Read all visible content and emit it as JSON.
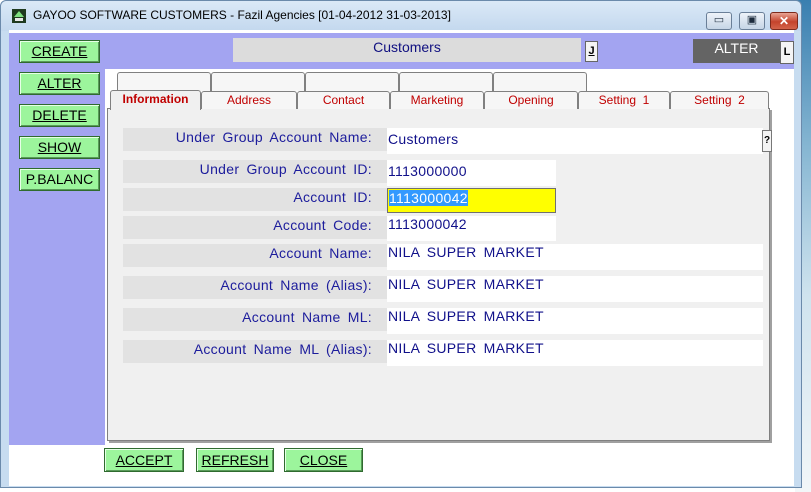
{
  "window": {
    "title": "GAYOO SOFTWARE CUSTOMERS - Fazil Agencies [01-04-2012 31-03-2013]",
    "controls": {
      "minimize": "▭",
      "maximize": "▣",
      "close": "✕"
    }
  },
  "side_buttons": [
    "CREATE",
    "ALTER",
    "DELETE",
    "SHOW",
    "P.BALANC"
  ],
  "header": {
    "title": "Customers",
    "j_button": "J",
    "mode": "ALTER",
    "l_button": "L"
  },
  "tabs": [
    "Information",
    "Address",
    "Contact",
    "Marketing",
    "Opening",
    "Setting  1",
    "Setting  2"
  ],
  "active_tab": "Information",
  "fields": [
    {
      "label": "Under Group Account Name:",
      "value": "Customers"
    },
    {
      "label": "Under Group Account ID:",
      "value": "1113000000"
    },
    {
      "label": "Account ID:",
      "value": "1113000042"
    },
    {
      "label": "Account Code:",
      "value": "1113000042"
    },
    {
      "label": "Account Name:",
      "value": "NILA SUPER MARKET"
    },
    {
      "label": "Account Name (Alias):",
      "value": "NILA SUPER MARKET"
    },
    {
      "label": "Account Name ML:",
      "value": "NILA SUPER MARKET"
    },
    {
      "label": "Account Name ML (Alias):",
      "value": "NILA SUPER MARKET"
    }
  ],
  "lookup_button": "?",
  "bottom_buttons": [
    "ACCEPT",
    "REFRESH",
    "CLOSE"
  ],
  "colors": {
    "button_green": "#9cf59c",
    "band_purple": "#a3a4f1",
    "tab_text": "#c00000",
    "field_text": "#1c1c9c",
    "focus_yellow": "#ffff00",
    "selection_blue": "#3399ff"
  },
  "icons": {
    "app": "app-icon"
  }
}
